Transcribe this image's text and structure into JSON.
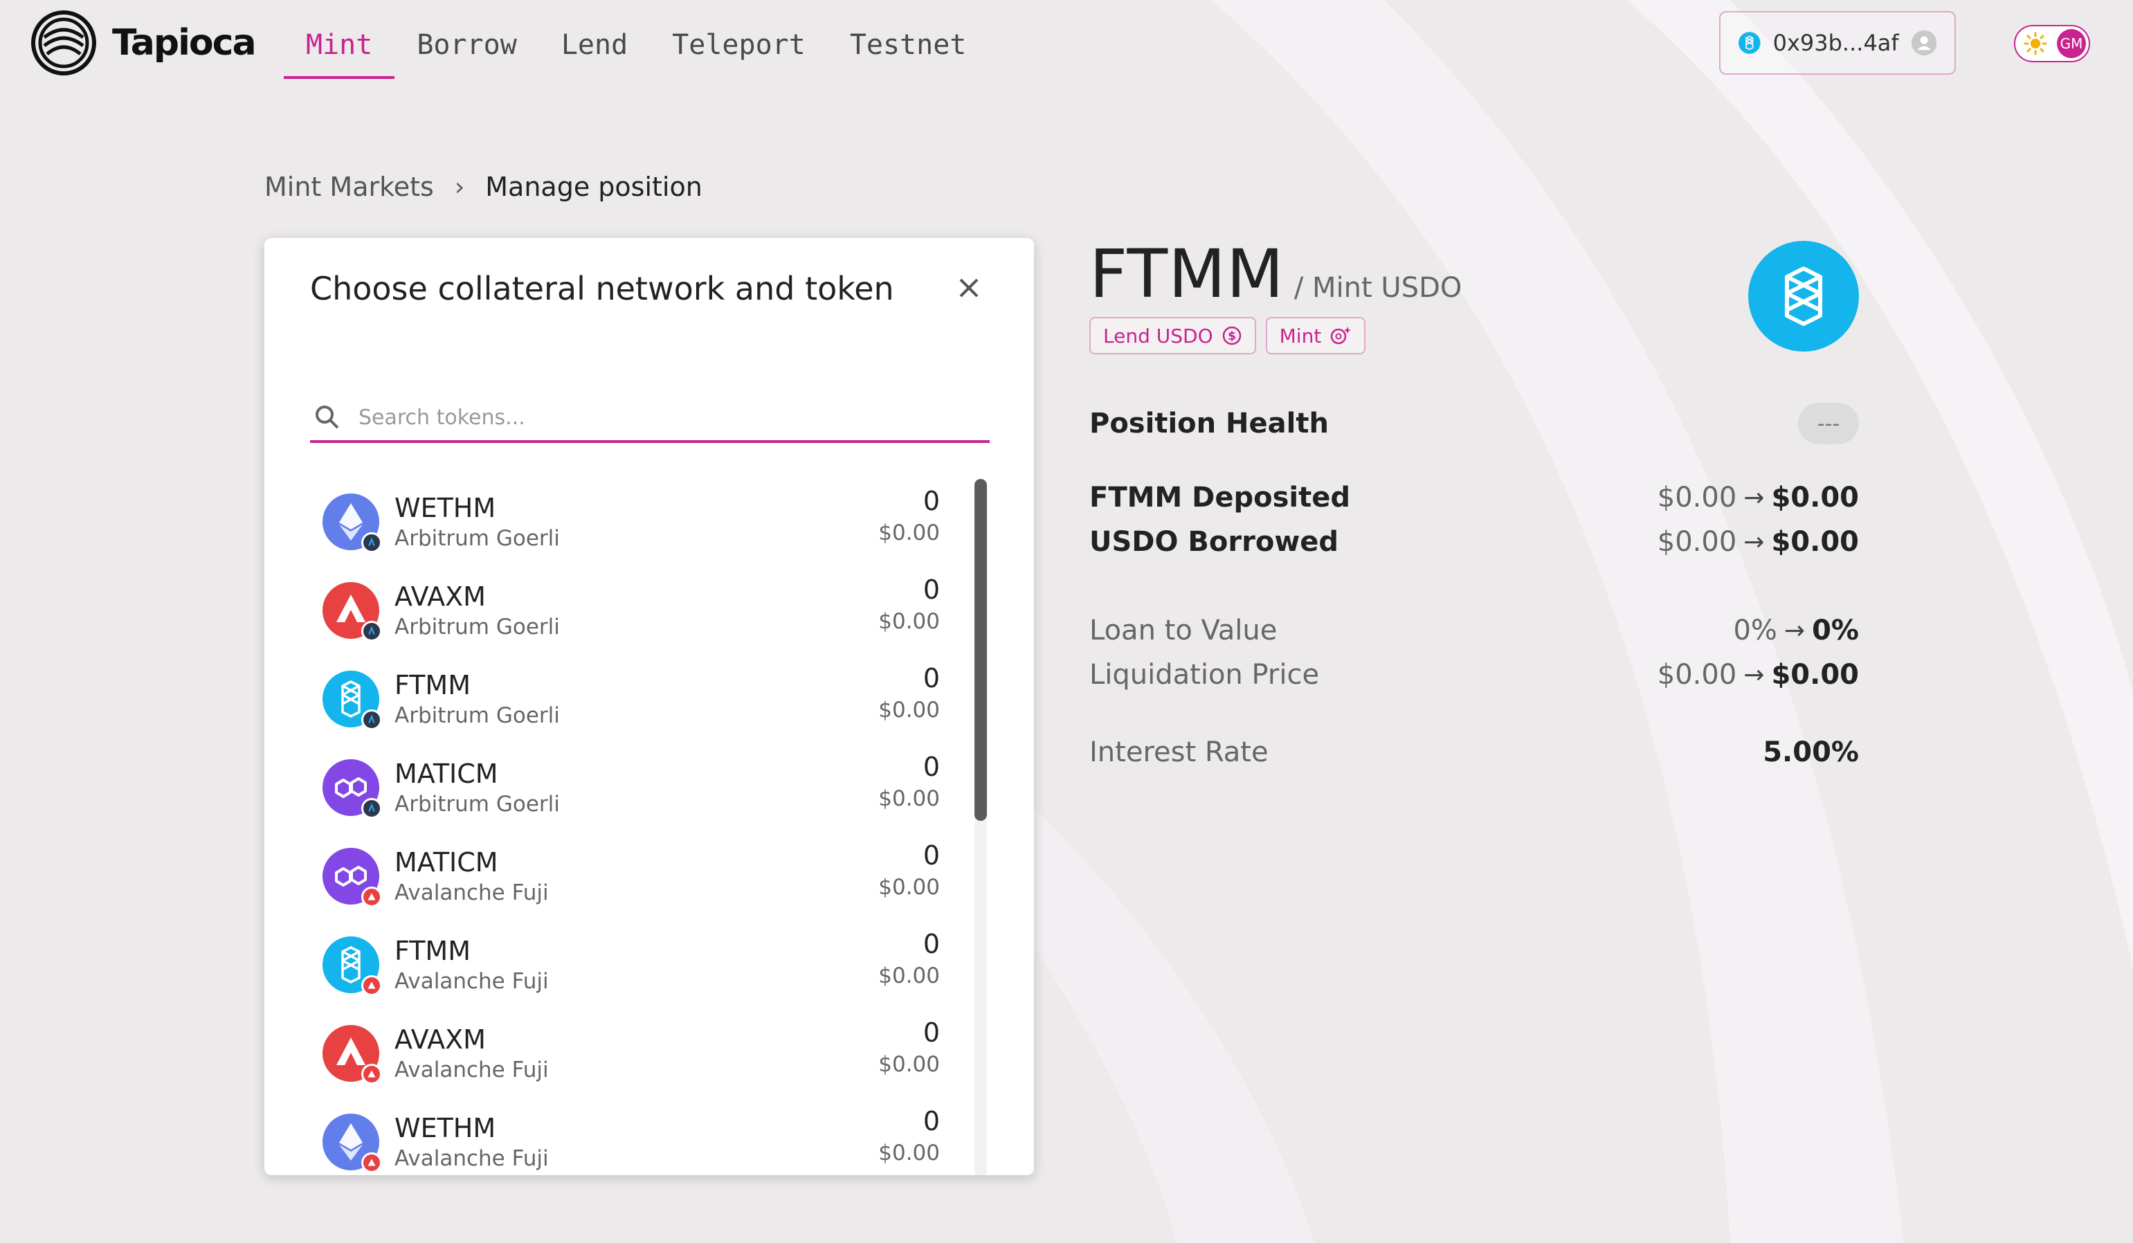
{
  "brand": {
    "name": "Tapioca"
  },
  "nav": {
    "items": [
      {
        "label": "Mint",
        "active": true
      },
      {
        "label": "Borrow",
        "active": false
      },
      {
        "label": "Lend",
        "active": false
      },
      {
        "label": "Teleport",
        "active": false
      },
      {
        "label": "Testnet",
        "active": false
      }
    ]
  },
  "wallet": {
    "address": "0x93b...4af",
    "network_icon": "fantom-icon",
    "avatar_icon": "user-avatar-icon"
  },
  "theme_toggle": {
    "icon": "sun-icon",
    "badge": "GM"
  },
  "breadcrumb": {
    "parent": "Mint Markets",
    "separator": "›",
    "current": "Manage position"
  },
  "modal": {
    "title": "Choose collateral network and token",
    "search_placeholder": "Search tokens...",
    "tokens": [
      {
        "symbol": "WETHM",
        "network": "Arbitrum Goerli",
        "balance": "0",
        "usd": "$0.00",
        "coin": "eth",
        "badge": "arbitrum"
      },
      {
        "symbol": "AVAXM",
        "network": "Arbitrum Goerli",
        "balance": "0",
        "usd": "$0.00",
        "coin": "avax",
        "badge": "arbitrum"
      },
      {
        "symbol": "FTMM",
        "network": "Arbitrum Goerli",
        "balance": "0",
        "usd": "$0.00",
        "coin": "ftm",
        "badge": "arbitrum"
      },
      {
        "symbol": "MATICM",
        "network": "Arbitrum Goerli",
        "balance": "0",
        "usd": "$0.00",
        "coin": "matic",
        "badge": "arbitrum"
      },
      {
        "symbol": "MATICM",
        "network": "Avalanche Fuji",
        "balance": "0",
        "usd": "$0.00",
        "coin": "matic",
        "badge": "avalanche"
      },
      {
        "symbol": "FTMM",
        "network": "Avalanche Fuji",
        "balance": "0",
        "usd": "$0.00",
        "coin": "ftm",
        "badge": "avalanche"
      },
      {
        "symbol": "AVAXM",
        "network": "Avalanche Fuji",
        "balance": "0",
        "usd": "$0.00",
        "coin": "avax",
        "badge": "avalanche"
      },
      {
        "symbol": "WETHM",
        "network": "Avalanche Fuji",
        "balance": "0",
        "usd": "$0.00",
        "coin": "eth",
        "badge": "avalanche"
      }
    ]
  },
  "market": {
    "symbol": "FTMM",
    "subtitle": "/ Mint USDO",
    "tags": [
      {
        "label": "Lend USDO",
        "icon": "dollar-circle-icon"
      },
      {
        "label": "Mint",
        "icon": "mint-sparkle-icon"
      }
    ],
    "logo_icon": "fantom-icon"
  },
  "stats": {
    "position_health": {
      "label": "Position Health",
      "value": "---"
    },
    "deposited": {
      "label": "FTMM Deposited",
      "from": "$0.00",
      "to": "$0.00"
    },
    "borrowed": {
      "label": "USDO Borrowed",
      "from": "$0.00",
      "to": "$0.00"
    },
    "ltv": {
      "label": "Loan to Value",
      "from": "0%",
      "to": "0%"
    },
    "liquidation": {
      "label": "Liquidation Price",
      "from": "$0.00",
      "to": "$0.00"
    },
    "interest": {
      "label": "Interest Rate",
      "value": "5.00%"
    }
  },
  "colors": {
    "accent": "#c8238f",
    "eth": "#627eea",
    "avax": "#e84142",
    "ftm": "#13b5ec",
    "matic": "#8247e5",
    "arbitrum": "#2d374b"
  }
}
